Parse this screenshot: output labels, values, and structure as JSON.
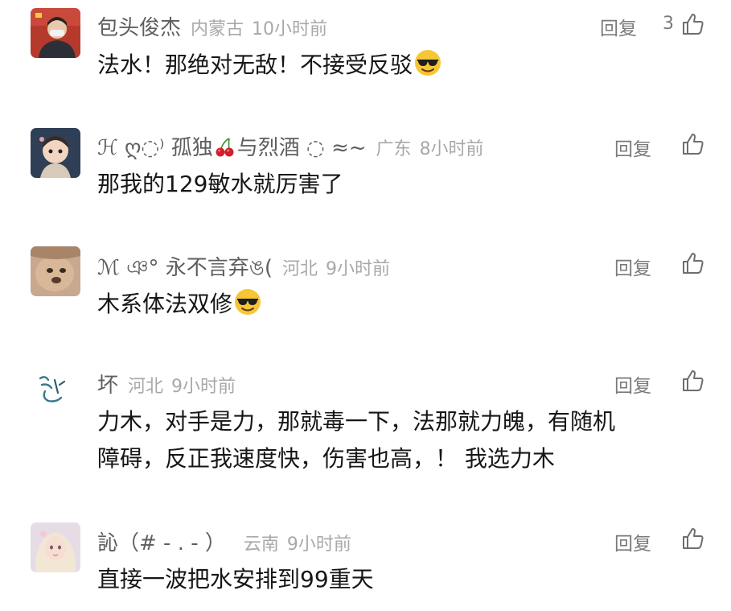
{
  "comments": [
    {
      "username": "包头俊杰",
      "location": "内蒙古",
      "time": "10小时前",
      "reply_label": "回复",
      "like_count": "3",
      "lines": [
        "法水！那绝对无敌！不接受反驳"
      ],
      "emoji": "cool-sunglasses"
    },
    {
      "username_prefix": "ℋ ღ◌⁾ 孤独",
      "username_suffix": "与烈酒 ◌ ≈~",
      "location": "广东",
      "time": "8小时前",
      "reply_label": "回复",
      "lines": [
        "那我的129敏水就厉害了"
      ]
    },
    {
      "username": "ℳ ঞ° 永不言弃ঙ(",
      "location": "河北",
      "time": "9小时前",
      "reply_label": "回复",
      "lines": [
        "木系体法双修"
      ],
      "emoji": "cool-sunglasses"
    },
    {
      "username": "坏",
      "location": "河北",
      "time": "9小时前",
      "reply_label": "回复",
      "lines": [
        "力木，对手是力，那就毒一下，法那就力魄，有随机",
        "障碍，反正我速度快，伤害也高，！ 我选力木"
      ]
    },
    {
      "username": "訫（# - . - ）",
      "location": "云南",
      "time": "9小时前",
      "reply_label": "回复",
      "lines": [
        "直接一波把水安排到99重天"
      ]
    }
  ],
  "colors": {
    "username": "#5e5e5e",
    "meta": "#a8a8a8",
    "text": "#161616",
    "action": "#7a7a7a"
  },
  "icons": [
    "like-icon",
    "cherry-emoji",
    "cool-sunglasses-emoji"
  ]
}
